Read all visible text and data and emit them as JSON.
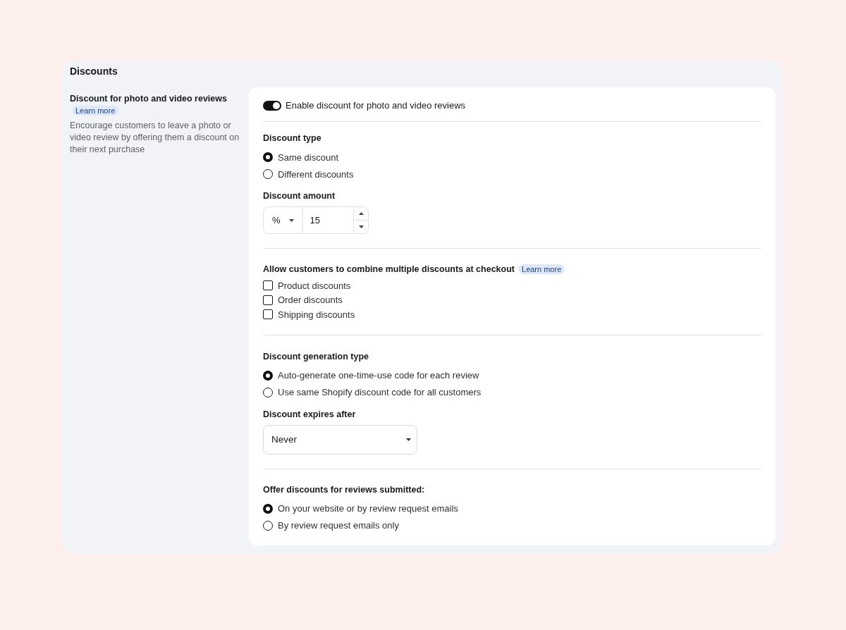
{
  "section_title": "Discounts",
  "sidebar": {
    "title": "Discount for photo and video reviews",
    "link": "Learn more",
    "description": "Encourage customers to leave a photo or video review by offering them a discount on their next purchase"
  },
  "enable_toggle": {
    "label": "Enable discount for photo and video reviews",
    "on": true
  },
  "discount_type": {
    "label": "Discount type",
    "options": [
      {
        "label": "Same discount",
        "selected": true
      },
      {
        "label": "Different discounts",
        "selected": false
      }
    ]
  },
  "discount_amount": {
    "label": "Discount amount",
    "unit": "%",
    "value": "15"
  },
  "combine": {
    "label": "Allow customers to combine multiple discounts at checkout",
    "link": "Learn more",
    "options": [
      {
        "label": "Product discounts",
        "checked": false
      },
      {
        "label": "Order discounts",
        "checked": false
      },
      {
        "label": "Shipping discounts",
        "checked": false
      }
    ]
  },
  "generation_type": {
    "label": "Discount generation type",
    "options": [
      {
        "label": "Auto-generate one-time-use code for each review",
        "selected": true
      },
      {
        "label": "Use same Shopify discount code for all customers",
        "selected": false
      }
    ]
  },
  "expires": {
    "label": "Discount expires after",
    "value": "Never"
  },
  "offer": {
    "label": "Offer discounts for reviews submitted:",
    "options": [
      {
        "label": "On your website or by review request emails",
        "selected": true
      },
      {
        "label": "By review request emails only",
        "selected": false
      }
    ]
  }
}
